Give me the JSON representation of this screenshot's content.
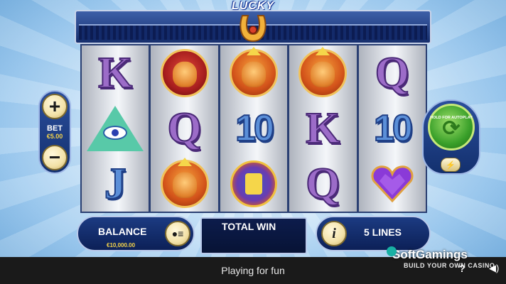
{
  "header": {
    "logo_text": "LUCKY"
  },
  "reels": [
    [
      {
        "type": "letter",
        "text": "K",
        "color": "purple"
      },
      {
        "type": "pyramid"
      },
      {
        "type": "letter",
        "text": "J",
        "color": "blue"
      }
    ],
    [
      {
        "type": "buffalo"
      },
      {
        "type": "letter",
        "text": "Q",
        "color": "purple"
      },
      {
        "type": "lion"
      }
    ],
    [
      {
        "type": "lion"
      },
      {
        "type": "ten",
        "text": "10",
        "color": "blue"
      },
      {
        "type": "mask"
      }
    ],
    [
      {
        "type": "lion"
      },
      {
        "type": "letter",
        "text": "K",
        "color": "purple"
      },
      {
        "type": "letter",
        "text": "Q",
        "color": "purple"
      }
    ],
    [
      {
        "type": "letter",
        "text": "Q",
        "color": "purple"
      },
      {
        "type": "ten",
        "text": "10",
        "color": "blue"
      },
      {
        "type": "heart"
      }
    ]
  ],
  "bet": {
    "plus": "+",
    "minus": "−",
    "label": "BET",
    "value": "€5.00"
  },
  "spin": {
    "autoplay_hint": "HOLD FOR AUTOPLAY",
    "icon": "refresh-arrows-icon",
    "turbo_icon": "lightning-icon"
  },
  "balance": {
    "label": "BALANCE",
    "value": "€10,000.00",
    "coin_icon": "coins-menu-icon"
  },
  "total_win": {
    "label": "TOTAL WIN"
  },
  "lines": {
    "label": "5 LINES",
    "info": "i"
  },
  "status": {
    "text": "Playing for fun"
  },
  "branding": {
    "name": "SoftGamings",
    "tagline": "BUILD YOUR OWN CASINO"
  },
  "colors": {
    "panel": "#13306e",
    "accent_gold": "#f3d34a",
    "spin_green": "#3aa02a"
  }
}
